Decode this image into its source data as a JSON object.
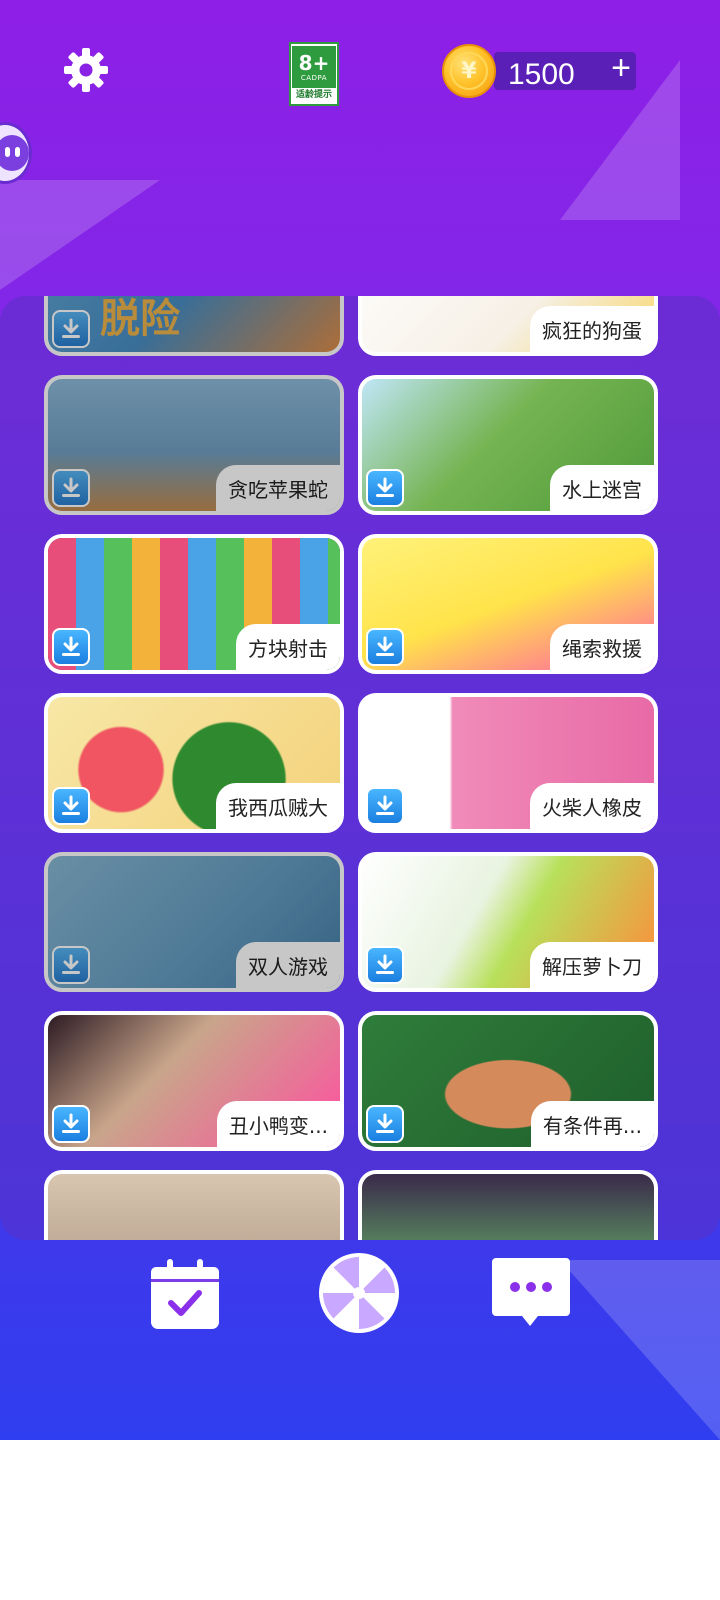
{
  "header": {
    "coins": "1500",
    "coin_plus": "+",
    "age_rating": "8+",
    "age_org": "CADPA",
    "age_note": "适龄提示"
  },
  "games": [
    {
      "name": "脱险",
      "row": 0,
      "col": 0,
      "dim": true
    },
    {
      "name": "疯狂的狗蛋",
      "row": 0,
      "col": 1,
      "dim": false
    },
    {
      "name": "贪吃苹果蛇",
      "row": 1,
      "col": 0,
      "dim": true
    },
    {
      "name": "水上迷宫",
      "row": 1,
      "col": 1,
      "dim": false
    },
    {
      "name": "方块射击",
      "row": 2,
      "col": 0,
      "dim": false
    },
    {
      "name": "绳索救援",
      "row": 2,
      "col": 1,
      "dim": false
    },
    {
      "name": "我西瓜贼大",
      "row": 3,
      "col": 0,
      "dim": false
    },
    {
      "name": "火柴人橡皮",
      "row": 3,
      "col": 1,
      "dim": false
    },
    {
      "name": "双人游戏",
      "row": 4,
      "col": 0,
      "dim": true
    },
    {
      "name": "解压萝卜刀",
      "row": 4,
      "col": 1,
      "dim": false
    },
    {
      "name": "丑小鸭变...",
      "row": 5,
      "col": 0,
      "dim": false
    },
    {
      "name": "有条件再...",
      "row": 5,
      "col": 1,
      "dim": false
    }
  ],
  "bottom_nav": [
    {
      "icon": "calendar-check-icon"
    },
    {
      "icon": "spin-wheel-icon"
    },
    {
      "icon": "chat-bubble-icon"
    }
  ],
  "colors": {
    "bg_top": "#8e1fe6",
    "bg_bottom": "#2f3ef0",
    "download_blue": "#1b7fe0"
  }
}
